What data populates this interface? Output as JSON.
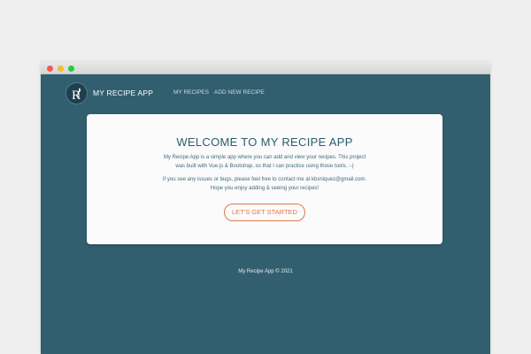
{
  "nav": {
    "brand": "MY RECIPE APP",
    "links": [
      "MY RECIPES",
      "ADD NEW RECIPE"
    ]
  },
  "welcome": {
    "title": "WELCOME TO MY RECIPE APP",
    "paragraph1": [
      "My Recipe App is a simple app where you can add and view your recipes. This project",
      "was built with Vue.js & Bootstrap, so that I can practice using those tools. :-)"
    ],
    "paragraph2": [
      "If you see any issues or bugs, please feel free to contact me at kbsniquez@gmail.com.",
      "Hope you enjoy adding & seeing your recipes!"
    ],
    "cta_label": "LET'S GET STARTED"
  },
  "footer": {
    "text": "My Recipe App © 2021"
  },
  "colors": {
    "background": "#325f70",
    "card": "#fbfbfb",
    "accent": "#e0754f",
    "title": "#2e5b6b"
  },
  "icons": {
    "logo": "logo-r-spoon-icon"
  }
}
